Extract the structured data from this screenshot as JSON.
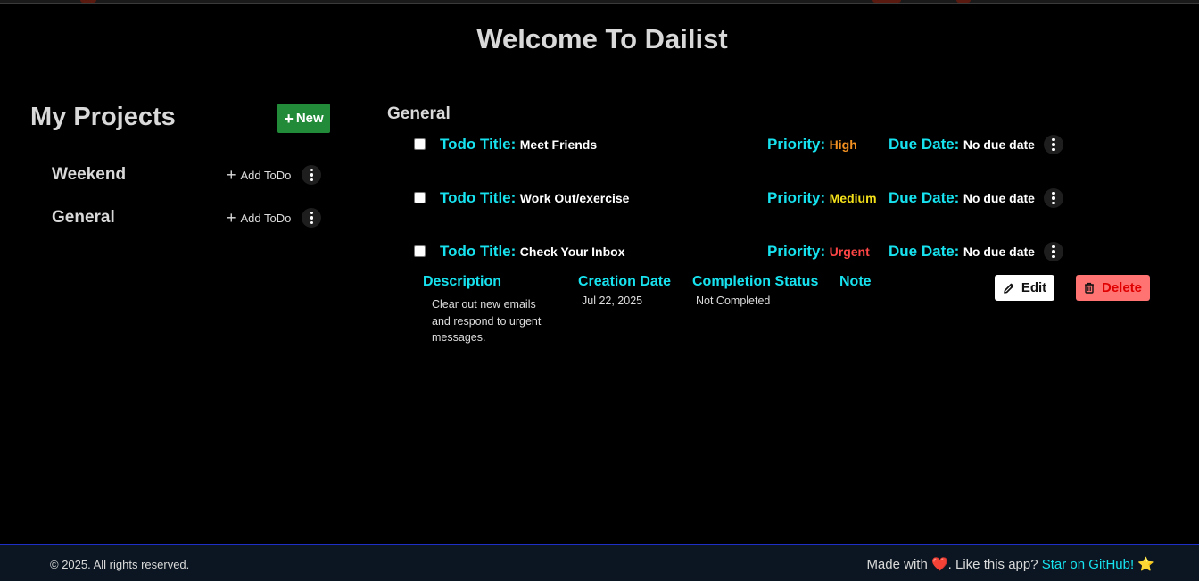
{
  "app": {
    "title": "Welcome To Dailist"
  },
  "sidebar": {
    "heading": "My Projects",
    "new_button": {
      "plus": "+",
      "label": "New"
    },
    "add_todo_plus": "+",
    "projects": [
      {
        "name": "Weekend",
        "add_label": "Add ToDo"
      },
      {
        "name": "General",
        "add_label": "Add ToDo"
      }
    ]
  },
  "main": {
    "project_title": "General",
    "labels": {
      "title": "Todo Title:",
      "priority": "Priority:",
      "due": "Due Date:"
    },
    "todos": [
      {
        "title": "Meet Friends",
        "priority": "High",
        "priority_color": "#f39121",
        "due": "No due date",
        "checked": false
      },
      {
        "title": "Work Out/exercise",
        "priority": "Medium",
        "priority_color": "#f5e11a",
        "due": "No due date",
        "checked": false
      },
      {
        "title": "Check Your Inbox",
        "priority": "Urgent",
        "priority_color": "#ff4646",
        "due": "No due date",
        "checked": false
      }
    ],
    "detail": {
      "description_label": "Description",
      "description": "Clear out new emails and respond to urgent messages.",
      "creation_label": "Creation Date",
      "creation_date": "Jul 22, 2025",
      "status_label": "Completion Status",
      "status": "Not Completed",
      "note_label": "Note",
      "edit_label": "Edit",
      "delete_label": "Delete"
    }
  },
  "footer": {
    "copyright": "© 2025. All rights reserved.",
    "made_with": "Made with",
    "heart": "❤️",
    "like_text": ". Like this app?",
    "github_link": "Star on GitHub!",
    "star": "⭐"
  },
  "colors": {
    "accent": "#17e3f0",
    "new_button": "#228b3a",
    "delete_button": "#ff7373",
    "footer_bg": "#0b1622"
  }
}
